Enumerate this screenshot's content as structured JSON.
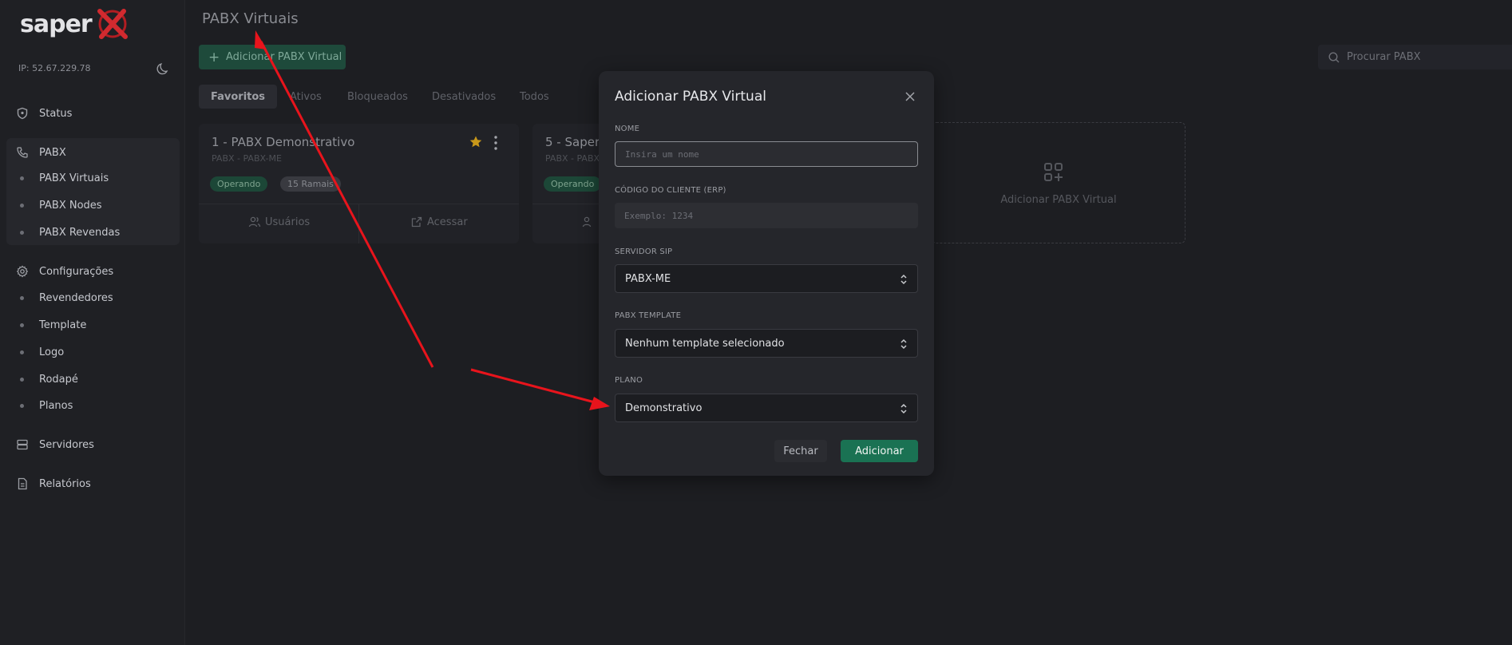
{
  "brand": {
    "name": "saper"
  },
  "sidebar": {
    "ip": "IP: 52.67.229.78",
    "items": [
      {
        "label": "Status",
        "icon": "shield-icon"
      },
      {
        "label": "PABX",
        "icon": "phone-icon"
      },
      {
        "label": "Configurações",
        "icon": "gear-icon"
      },
      {
        "label": "Servidores",
        "icon": "server-icon"
      },
      {
        "label": "Relatórios",
        "icon": "file-icon"
      }
    ],
    "pabx_sub": [
      "PABX Virtuais",
      "PABX Nodes",
      "PABX Revendas"
    ],
    "config_sub": [
      "Revendedores",
      "Template",
      "Logo",
      "Rodapé",
      "Planos"
    ]
  },
  "header": {
    "title": "PABX Virtuais",
    "add_button": "Adicionar PABX Virtual",
    "search_placeholder": "Procurar PABX"
  },
  "tabs": [
    "Favoritos",
    "Ativos",
    "Bloqueados",
    "Desativados",
    "Todos"
  ],
  "cards": [
    {
      "title": "1 - PABX Demonstrativo",
      "subtitle": "PABX - PABX-ME",
      "status": "Operando",
      "ramais": "15 Ramais",
      "users": "Usuários",
      "access": "Acessar"
    },
    {
      "title": "5 - Saper",
      "subtitle": "PABX - PABX",
      "status": "Operando"
    }
  ],
  "add_card_label": "Adicionar PABX Virtual",
  "modal": {
    "title": "Adicionar PABX Virtual",
    "nome_label": "NOME",
    "nome_placeholder": "Insira um nome",
    "erp_label": "CÓDIGO DO CLIENTE (ERP)",
    "erp_placeholder": "Exemplo: 1234",
    "sip_label": "SERVIDOR SIP",
    "sip_value": "PABX-ME",
    "template_label": "PABX TEMPLATE",
    "template_value": "Nenhum template selecionado",
    "plano_label": "PLANO",
    "plano_value": "Demonstrativo",
    "close_label": "Fechar",
    "add_label": "Adicionar"
  },
  "colors": {
    "accent": "#1a7253",
    "arrow": "#e8141c",
    "star": "#d4a017"
  }
}
